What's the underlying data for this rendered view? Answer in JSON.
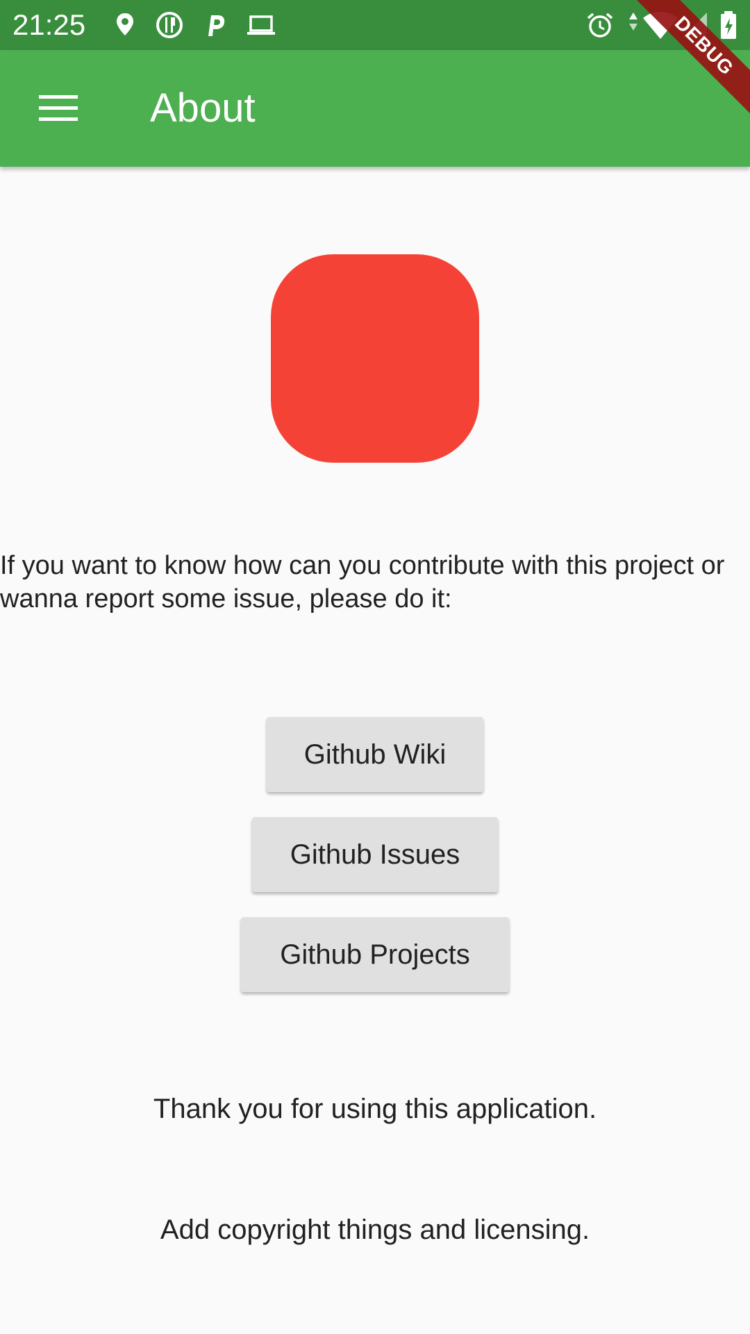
{
  "status_bar": {
    "time": "21:25",
    "left_icons": [
      "location-pin-icon",
      "food-delivery-icon",
      "parking-icon",
      "laptop-icon"
    ],
    "right_icons": [
      "alarm-icon",
      "data-arrows-icon",
      "wifi-icon",
      "cell-signal-icon",
      "battery-charging-icon"
    ]
  },
  "debug_banner": {
    "label": "DEBUG"
  },
  "app_bar": {
    "menu_icon": "menu-icon",
    "title": "About"
  },
  "main": {
    "logo_color": "#f44336",
    "intro_text": "If you want to know how can you contribute with this project or wanna report some issue, please do it:",
    "buttons": [
      {
        "label": "Github Wiki"
      },
      {
        "label": "Github Issues"
      },
      {
        "label": "Github Projects"
      }
    ],
    "thank_you_text": "Thank you for using this application.",
    "copyright_text": "Add copyright things and licensing."
  },
  "colors": {
    "status_bar": "#388e3c",
    "app_bar": "#4caf50",
    "background": "#fafafa",
    "button": "#e0e0e0",
    "debug_ribbon": "#961414"
  }
}
